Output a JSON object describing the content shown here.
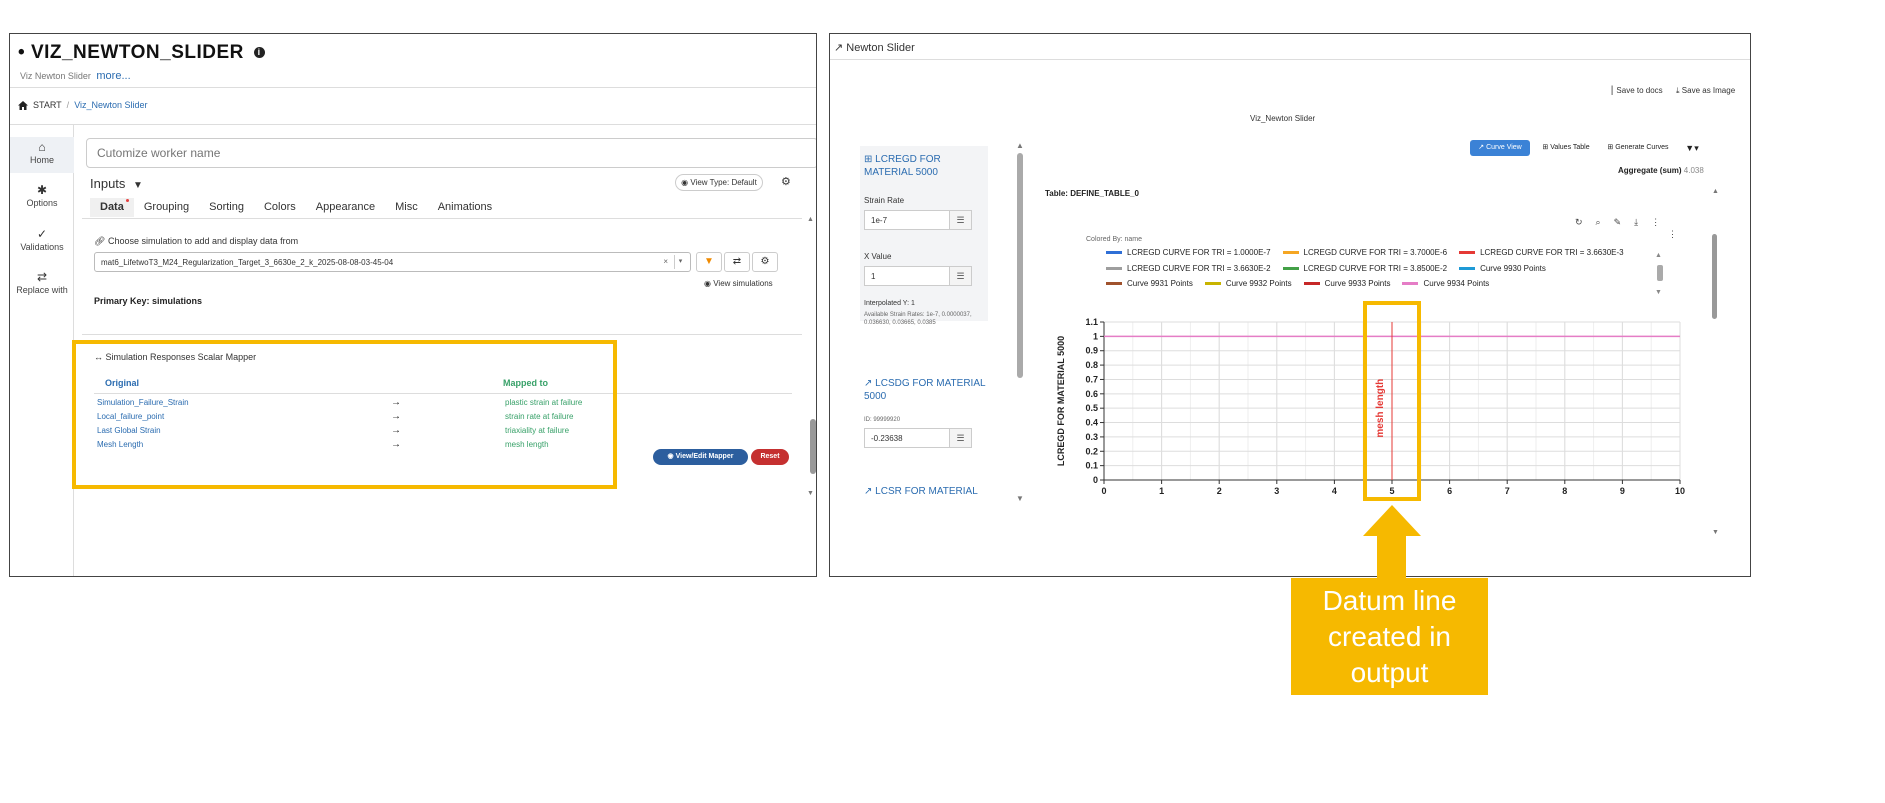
{
  "left": {
    "title": "VIZ_NEWTON_SLIDER",
    "title_prefix": "•",
    "subtitle": "Viz Newton Slider",
    "more_link": "more...",
    "breadcrumb": {
      "start": "START",
      "current": "Viz_Newton Slider"
    },
    "rail": [
      {
        "label": "Home",
        "icon": "home-icon"
      },
      {
        "label": "Options",
        "icon": "gear-icon"
      },
      {
        "label": "Validations",
        "icon": "check-icon"
      },
      {
        "label": "Replace with",
        "icon": "swap-icon"
      }
    ],
    "worker_placeholder": "Cutomize worker name",
    "inputs_label": "Inputs",
    "view_type": "View Type: Default",
    "tabs": [
      "Data",
      "Grouping",
      "Sorting",
      "Colors",
      "Appearance",
      "Misc",
      "Animations"
    ],
    "choose_label": "Choose simulation to add and display data from",
    "selected_simulation": "mat6_LifetwoT3_M24_Regularization_Target_3_6630e_2_k_2025-08-08-03-45-04",
    "view_simulations": "View simulations",
    "primary_key": "Primary Key: simulations",
    "mapper": {
      "title": "Simulation Responses Scalar Mapper",
      "col_original": "Original",
      "col_mapped": "Mapped to",
      "arrow": "→",
      "rows": [
        {
          "original": "Simulation_Failure_Strain",
          "mapped": "plastic strain at failure"
        },
        {
          "original": "Local_failure_point",
          "mapped": "strain rate at failure"
        },
        {
          "original": "Last Global Strain",
          "mapped": "triaxiality at failure"
        },
        {
          "original": "Mesh Length",
          "mapped": "mesh length"
        }
      ],
      "view_edit": "View/Edit Mapper",
      "reset": "Reset"
    }
  },
  "right": {
    "header": "Newton Slider",
    "save_docs": "Save to docs",
    "save_image": "Save as Image",
    "viz_title": "Viz_Newton Slider",
    "materials": [
      {
        "heading": "LCREGD FOR MATERIAL 5000"
      },
      {
        "heading": "LCSDG FOR MATERIAL 5000"
      },
      {
        "heading": "LCSR FOR MATERIAL"
      }
    ],
    "strain_rate_label": "Strain Rate",
    "strain_rate_value": "1e-7",
    "x_value_label": "X Value",
    "x_value": "1",
    "interp_label": "Interpolated Y: 1",
    "interp_note": "Available Strain Rates: 1e-7, 0.0000037, 0.036630, 0.03665, 0.0385",
    "id_label": "ID: 99999920",
    "lcsdg_value": "-0.23638",
    "view_buttons": [
      "Curve View",
      "Values Table",
      "Generate Curves"
    ],
    "table_name": "Table: DEFINE_TABLE_0",
    "aggregate_label": "Aggregate (sum)",
    "aggregate_value": "4.038",
    "colored_by": "Colored By: name",
    "callout": "Datum line created in output"
  },
  "chart_data": {
    "type": "line",
    "ylabel": "LCREGD FOR MATERIAL 5000",
    "xlim": [
      0,
      10
    ],
    "ylim": [
      0,
      1.1
    ],
    "x_ticks": [
      "0",
      "1",
      "2",
      "3",
      "4",
      "5",
      "6",
      "7",
      "8",
      "9",
      "10"
    ],
    "y_ticks": [
      "0",
      "0.1",
      "0.2",
      "0.3",
      "0.4",
      "0.5",
      "0.6",
      "0.7",
      "0.8",
      "0.9",
      "1",
      "1.1"
    ],
    "grid": true,
    "legend_position": "top",
    "series": [
      {
        "name": "LCREGD CURVE FOR TRI = 1.0000E-7",
        "color": "#2f6fd6"
      },
      {
        "name": "LCREGD CURVE FOR TRI = 3.7000E-6",
        "color": "#f5a623"
      },
      {
        "name": "LCREGD CURVE FOR TRI = 3.6630E-3",
        "color": "#e53935"
      },
      {
        "name": "LCREGD CURVE FOR TRI = 3.6630E-2",
        "color": "#9e9e9e"
      },
      {
        "name": "LCREGD CURVE FOR TRI = 3.8500E-2",
        "color": "#43a047"
      },
      {
        "name": "Curve 9930 Points",
        "color": "#1e9ad6"
      },
      {
        "name": "Curve 9931 Points",
        "color": "#a0522d"
      },
      {
        "name": "Curve 9932 Points",
        "color": "#c8b400"
      },
      {
        "name": "Curve 9933 Points",
        "color": "#c62828"
      },
      {
        "name": "Curve 9934 Points",
        "color": "#e57dc6",
        "x": [
          0,
          10
        ],
        "y": [
          1,
          1
        ]
      }
    ],
    "datum_line": {
      "x": 5,
      "label": "mesh length",
      "color": "#e53935"
    }
  }
}
